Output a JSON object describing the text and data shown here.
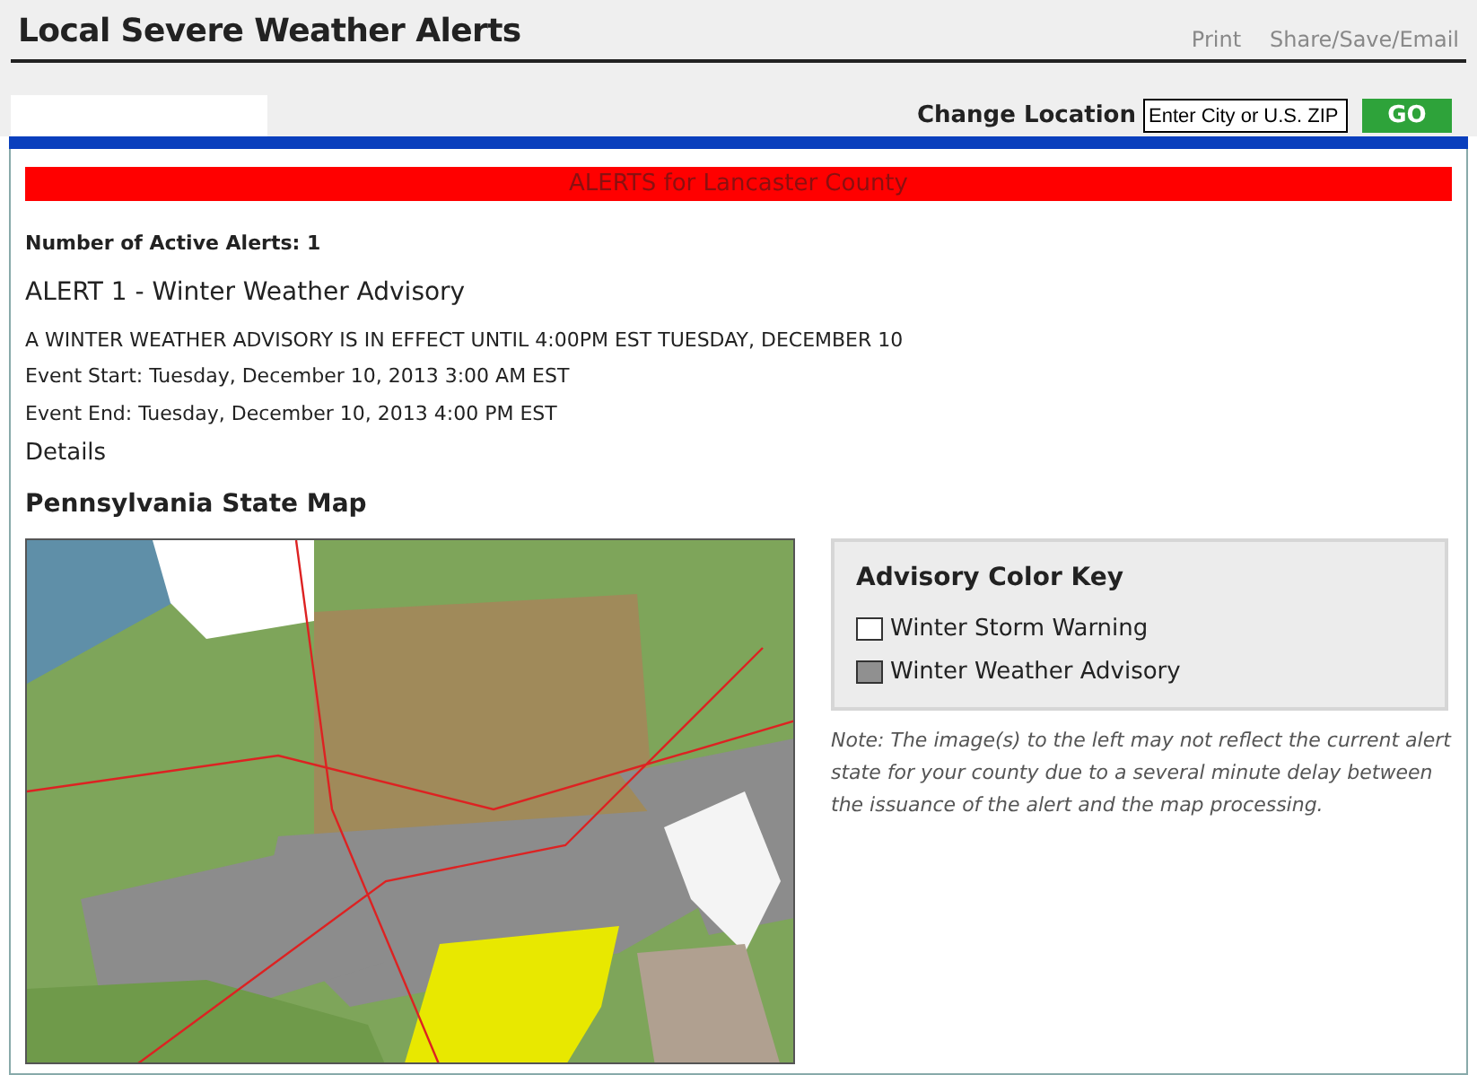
{
  "header": {
    "title": "Local Severe Weather Alerts",
    "links": [
      "Print",
      "Share/Save/Email"
    ]
  },
  "location": {
    "label": "Change Location",
    "placeholder": "Enter City or U.S. ZIP",
    "button": "GO"
  },
  "banner": "ALERTS for Lancaster County",
  "count": "Number of Active Alerts: 1",
  "alerts": [
    {
      "title": "ALERT 1 - Winter Weather Advisory",
      "summary": "A WINTER WEATHER ADVISORY IS IN EFFECT UNTIL 4:00PM EST TUESDAY, DECEMBER 10",
      "start": "Event Start: Tuesday, December 10, 2013 3:00 AM EST",
      "end": "Event End: Tuesday, December 10, 2013 4:00 PM EST",
      "details": "Details"
    }
  ],
  "map": {
    "title": "Pennsylvania State Map",
    "kind": "picture"
  },
  "key": {
    "title": "Advisory Color Key",
    "items": [
      {
        "label": "Winter Storm Warning",
        "color": "#ffffff"
      },
      {
        "label": "Winter Weather Advisory",
        "color": "#909090"
      }
    ]
  },
  "note": "Note: The image(s) to the left may not reflect the current alert state for your county due to a several minute delay between the issuance of the alert and the map processing."
}
